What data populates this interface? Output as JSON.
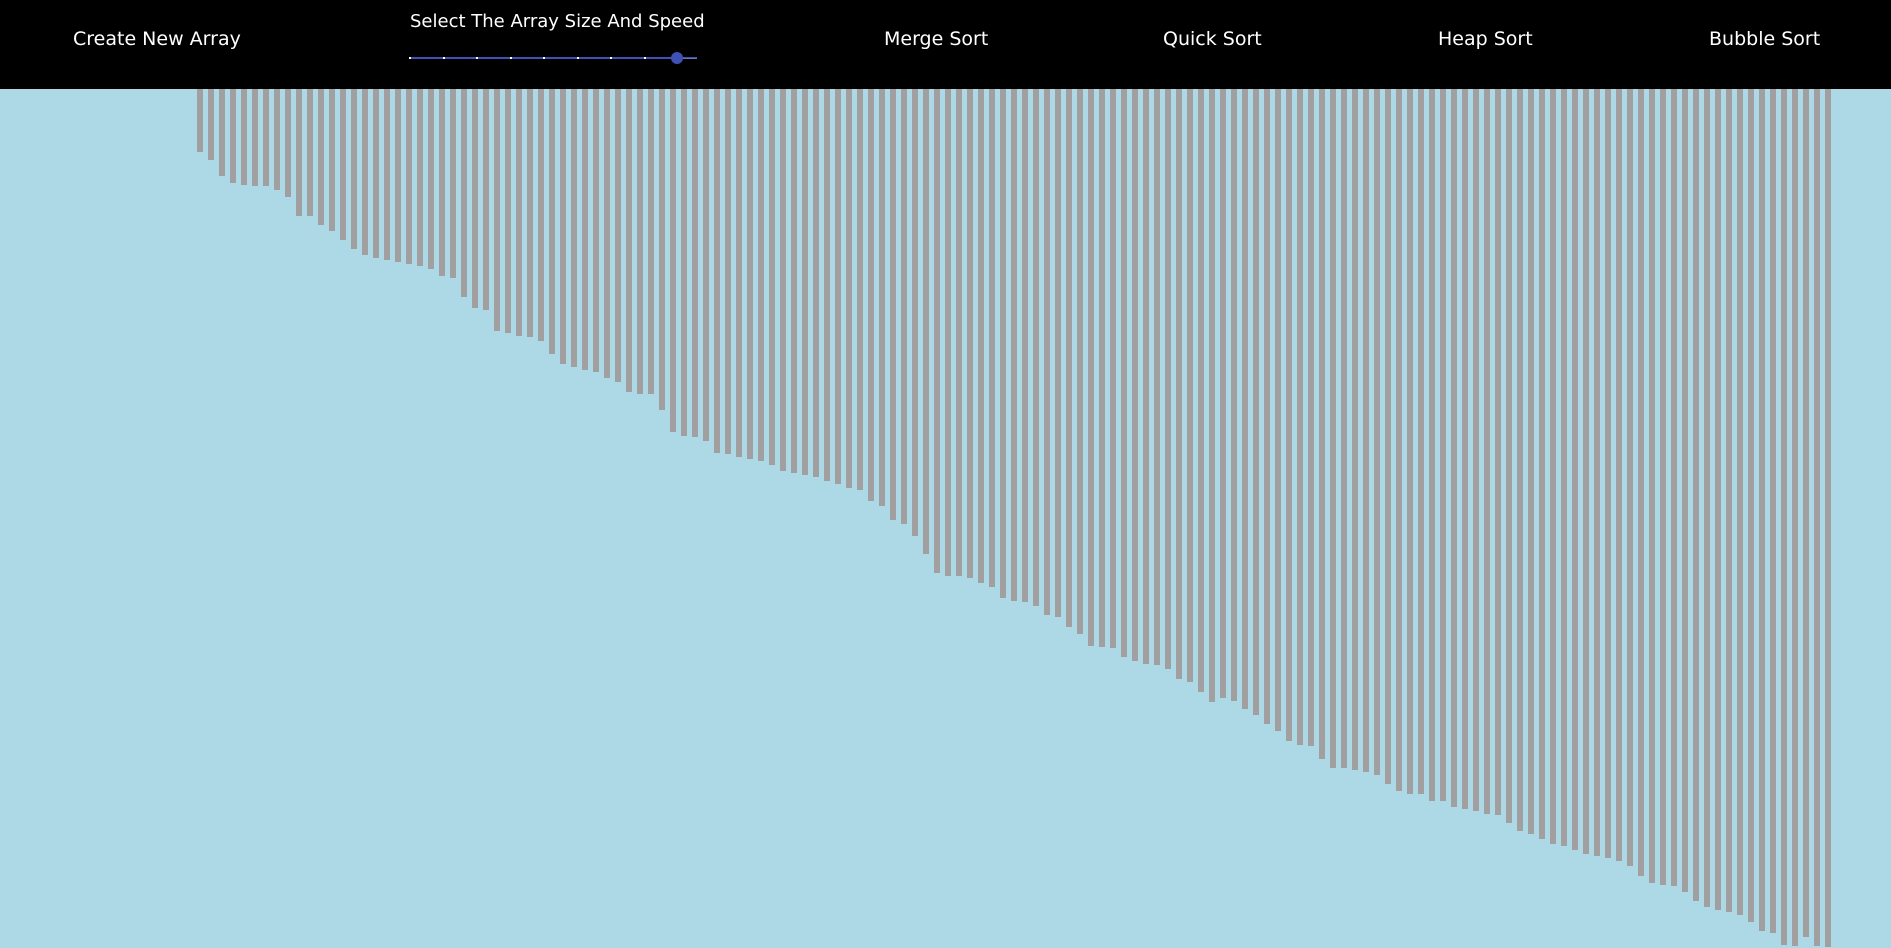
{
  "nav": {
    "create_label": "Create New Array",
    "slider_title": "Select The Array Size And Speed",
    "merge_label": "Merge Sort",
    "quick_label": "Quick Sort",
    "heap_label": "Heap Sort",
    "bubble_label": "Bubble Sort"
  },
  "slider": {
    "value_fraction": 0.93,
    "marks": 9
  },
  "colors": {
    "background": "#add8e6",
    "navbar": "#000000",
    "bar": "#a19f9f",
    "slider": "#3f51b5"
  },
  "array": [
    63,
    71,
    87,
    94,
    96,
    97,
    97,
    101,
    108,
    127,
    127,
    136,
    142,
    151,
    160,
    166,
    169,
    171,
    173,
    175,
    177,
    180,
    187,
    189,
    208,
    219,
    221,
    242,
    244,
    247,
    248,
    252,
    265,
    275,
    278,
    281,
    283,
    289,
    293,
    303,
    305,
    305,
    321,
    343,
    347,
    348,
    352,
    364,
    365,
    368,
    370,
    372,
    376,
    382,
    384,
    386,
    388,
    392,
    395,
    399,
    401,
    412,
    417,
    431,
    435,
    447,
    465,
    484,
    487,
    487,
    489,
    494,
    498,
    509,
    512,
    513,
    517,
    526,
    528,
    538,
    545,
    557,
    558,
    559,
    568,
    572,
    575,
    576,
    580,
    590,
    593,
    603,
    613,
    609,
    612,
    620,
    626,
    635,
    642,
    652,
    656,
    657,
    670,
    679,
    679,
    681,
    683,
    686,
    695,
    702,
    705,
    705,
    712,
    712,
    718,
    720,
    722,
    725,
    726,
    734,
    742,
    745,
    750,
    755,
    757,
    761,
    765,
    767,
    769,
    772,
    777,
    787,
    794,
    796,
    797,
    803,
    812,
    818,
    821,
    823,
    826,
    833,
    842,
    844,
    856,
    857,
    848,
    857,
    858
  ]
}
